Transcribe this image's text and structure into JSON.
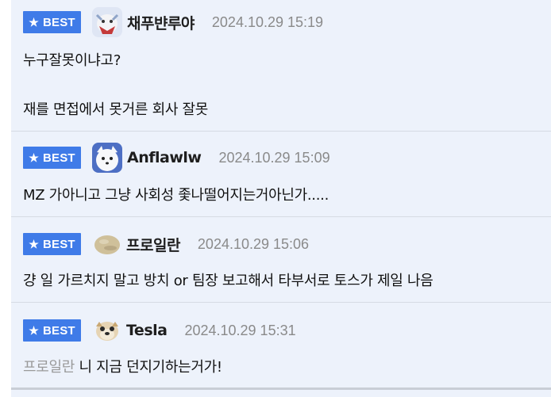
{
  "badge_label": "BEST",
  "comments": [
    {
      "nickname": "채푸뱐루야",
      "time": "2024.10.29 15:19",
      "lines": [
        "누구잘못이냐고?",
        "재를 면접에서 못거른 회사 잘못"
      ]
    },
    {
      "nickname": "Anflawlw",
      "time": "2024.10.29 15:09",
      "lines": [
        "MZ 가아니고 그냥 사회성 좇나떨어지는거아닌가....."
      ]
    },
    {
      "nickname": "프로일란",
      "time": "2024.10.29 15:06",
      "lines": [
        "걍 일 가르치지 말고 방치 or 팀장 보고해서 타부서로 토스가 제일 나음"
      ]
    },
    {
      "nickname": "Tesla",
      "time": "2024.10.29 15:31",
      "mention": "프로일란",
      "lines": [
        " 니 지금 던지기하는거가!"
      ]
    }
  ]
}
